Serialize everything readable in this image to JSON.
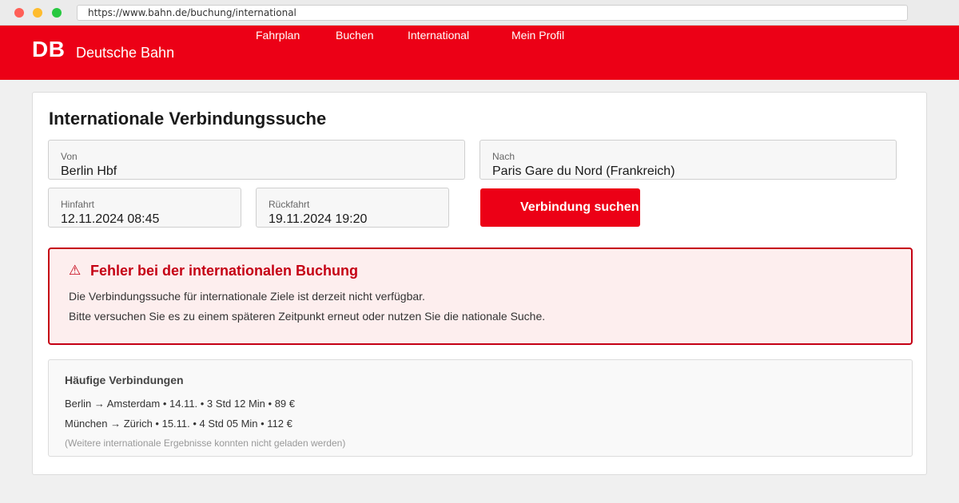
{
  "browser": {
    "url": "https://www.bahn.de/buchung/international"
  },
  "header": {
    "logo": "DB",
    "brand": "Deutsche Bahn",
    "nav": [
      "Fahrplan",
      "Buchen",
      "International",
      "Mein Profil"
    ]
  },
  "search": {
    "title": "Internationale Verbindungssuche",
    "from": {
      "label": "Von",
      "value": "Berlin Hbf"
    },
    "to": {
      "label": "Nach",
      "value": "Paris Gare du Nord (Frankreich)"
    },
    "outbound": {
      "label": "Hinfahrt",
      "value": "12.11.2024 08:45"
    },
    "return": {
      "label": "Rückfahrt",
      "value": "19.11.2024 19:20"
    },
    "button_label": "Verbindung suchen"
  },
  "error": {
    "icon": "warning-icon",
    "symbol": "⚠",
    "title": "Fehler bei der internationalen Buchung",
    "lines": [
      "Die Verbindungssuche für internationale Ziele ist derzeit nicht verfügbar.",
      "Bitte versuchen Sie es zu einem späteren Zeitpunkt erneut oder nutzen Sie die nationale Suche."
    ]
  },
  "frequent": {
    "title": "Häufige Verbindungen",
    "items": [
      "Berlin → Amsterdam • 14.11. • 3 Std 12 Min • 89 €",
      "München → Zürich • 15.11. • 4 Std 05 Min • 112 €"
    ],
    "note": "(Weitere internationale Ergebnisse konnten nicht geladen werden)"
  },
  "colors": {
    "brand_red": "#ec0016",
    "error_red": "#c50014",
    "error_bg": "#fdeeee"
  }
}
